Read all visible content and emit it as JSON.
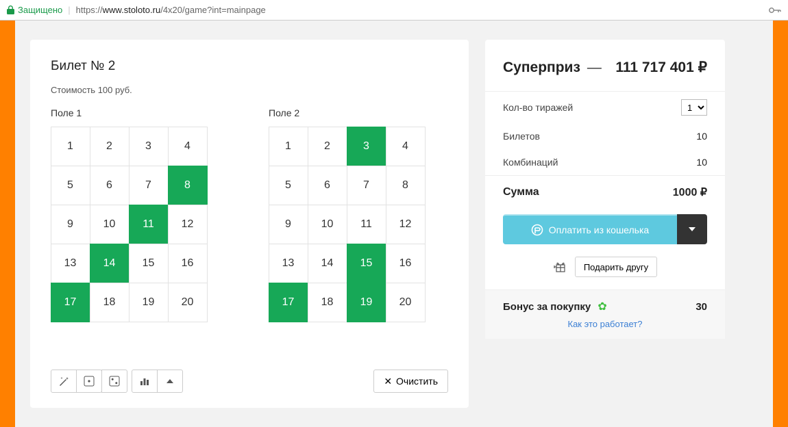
{
  "browser": {
    "secure_label": "Защищено",
    "url_prefix": "https://",
    "url_host": "www.stoloto.ru",
    "url_path": "/4x20/game?int=mainpage"
  },
  "ticket": {
    "title": "Билет № 2",
    "cost": "Стоимость 100 руб.",
    "field1_label": "Поле 1",
    "field2_label": "Поле 2",
    "field1_selected": [
      8,
      11,
      14,
      17
    ],
    "field2_selected": [
      3,
      15,
      17,
      19
    ],
    "numbers": [
      1,
      2,
      3,
      4,
      5,
      6,
      7,
      8,
      9,
      10,
      11,
      12,
      13,
      14,
      15,
      16,
      17,
      18,
      19,
      20
    ],
    "clear_label": "Очистить"
  },
  "side": {
    "prize_label": "Суперприз",
    "prize_dash": "—",
    "prize_value": "111 717 401 ₽",
    "draws_label": "Кол-во тиражей",
    "draws_value": "1",
    "tickets_label": "Билетов",
    "tickets_value": "10",
    "combos_label": "Комбинаций",
    "combos_value": "10",
    "sum_label": "Сумма",
    "sum_value": "1000 ₽",
    "pay_label": "Оплатить из кошелька",
    "gift_label": "Подарить другу",
    "bonus_label": "Бонус за покупку",
    "bonus_value": "30",
    "how_link": "Как это работает?"
  }
}
